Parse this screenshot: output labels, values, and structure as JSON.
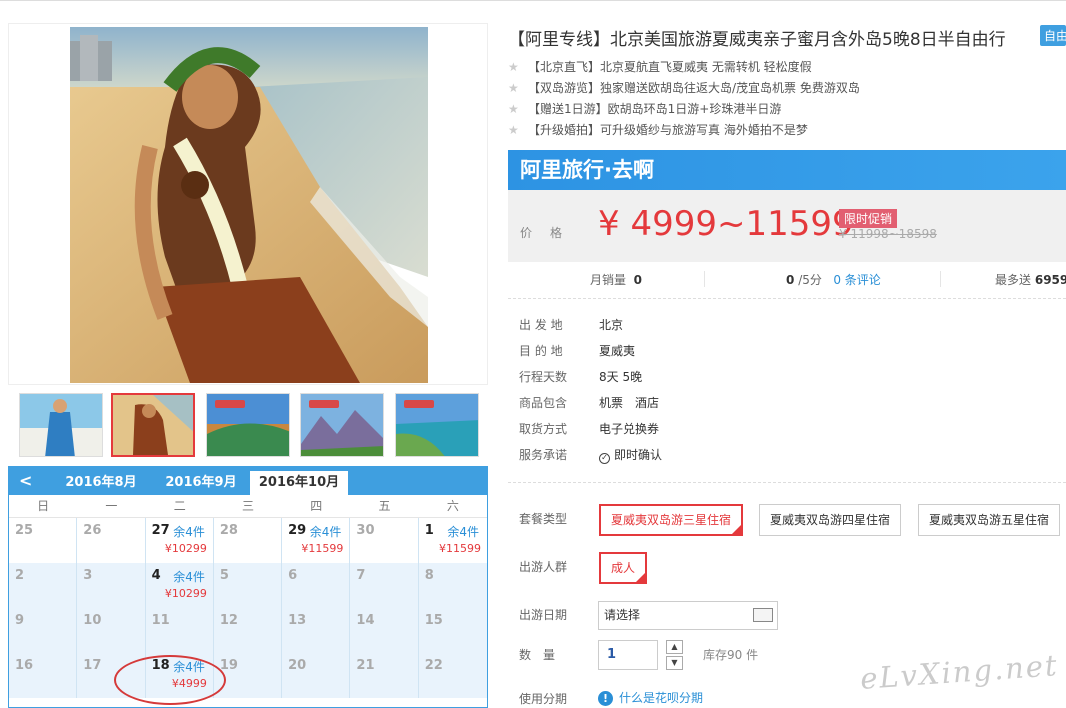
{
  "product": {
    "title": "【阿里专线】北京美国旅游夏威夷亲子蜜月含外岛5晚8日半自由行",
    "tag": "自由",
    "features": [
      "【北京直飞】北京夏航直飞夏威夷 无需转机 轻松度假",
      "【双岛游览】独家赠送欧胡岛往返大岛/茂宜岛机票 免费游双岛",
      "【赠送1日游】欧胡岛环岛1日游+珍珠港半日游",
      "【升级婚拍】可升级婚纱与旅游写真 海外婚拍不是梦"
    ]
  },
  "banner": {
    "text": "阿里旅行·去啊"
  },
  "price": {
    "label": "价格",
    "value": "¥ 4999~11599",
    "promo": "限时促销",
    "original": "¥ 11998~18598"
  },
  "stats": {
    "sales_label": "月销量",
    "sales_value": "0",
    "score": "0",
    "score_unit": "/5分",
    "reviews": "0 条评论",
    "points_label": "最多送",
    "points_value": "6959"
  },
  "info": [
    {
      "k": "出 发 地",
      "v": "北京"
    },
    {
      "k": "目 的 地",
      "v": "夏威夷"
    },
    {
      "k": "行程天数",
      "v": "8天 5晚"
    },
    {
      "k": "商品包含",
      "v": "机票　酒店"
    },
    {
      "k": "取货方式",
      "v": "电子兑换券"
    },
    {
      "k": "服务承诺",
      "v": "即时确认"
    }
  ],
  "options": {
    "package_label": "套餐类型",
    "packages": [
      "夏威夷双岛游三星住宿",
      "夏威夷双岛游四星住宿",
      "夏威夷双岛游五星住宿"
    ],
    "crowd_label": "出游人群",
    "crowd": "成人",
    "date_label": "出游日期",
    "date_placeholder": "请选择",
    "qty_label": "数　量",
    "qty": "1",
    "stock": "库存90 件",
    "finance_label": "使用分期",
    "finance_link": "什么是花呗分期"
  },
  "calendar": {
    "months": [
      "2016年8月",
      "2016年9月",
      "2016年10月"
    ],
    "active_month": 2,
    "weekdays": [
      "日",
      "一",
      "二",
      "三",
      "四",
      "五",
      "六"
    ],
    "rows": [
      [
        {
          "d": "25"
        },
        {
          "d": "26"
        },
        {
          "d": "27",
          "rem": "余4件",
          "price": "¥10299"
        },
        {
          "d": "28"
        },
        {
          "d": "29",
          "rem": "余4件",
          "price": "¥11599"
        },
        {
          "d": "30"
        },
        {
          "d": "1",
          "rem": "余4件",
          "price": "¥11599"
        }
      ],
      [
        {
          "d": "2"
        },
        {
          "d": "3"
        },
        {
          "d": "4",
          "rem": "余4件",
          "price": "¥10299"
        },
        {
          "d": "5"
        },
        {
          "d": "6"
        },
        {
          "d": "7"
        },
        {
          "d": "8"
        }
      ],
      [
        {
          "d": "9"
        },
        {
          "d": "10"
        },
        {
          "d": "11"
        },
        {
          "d": "12"
        },
        {
          "d": "13"
        },
        {
          "d": "14"
        },
        {
          "d": "15"
        }
      ],
      [
        {
          "d": "16"
        },
        {
          "d": "17"
        },
        {
          "d": "18",
          "rem": "余4件",
          "price": "¥4999"
        },
        {
          "d": "19"
        },
        {
          "d": "20"
        },
        {
          "d": "21"
        },
        {
          "d": "22"
        }
      ]
    ]
  },
  "watermark": "eLvXing.net",
  "colors": {
    "accent": "#3f9fe0",
    "price": "#e4393c",
    "promo": "#e25f71"
  }
}
